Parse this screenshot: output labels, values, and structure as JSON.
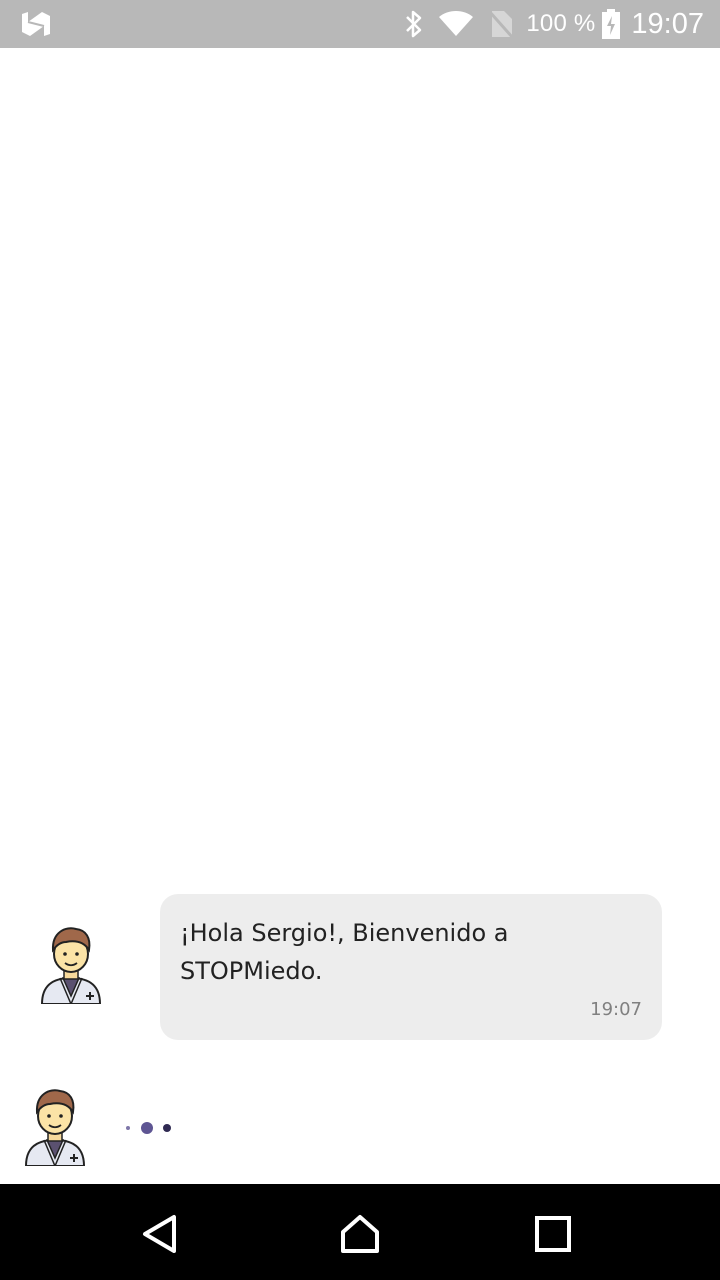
{
  "status_bar": {
    "battery_percent": "100 %",
    "time": "19:07",
    "icons": [
      "n-logo-icon",
      "bluetooth-icon",
      "wifi-icon",
      "no-sim-icon",
      "battery-charging-icon"
    ]
  },
  "chat": {
    "messages": [
      {
        "sender": "bot",
        "avatar": "doctor-avatar-icon",
        "text": "¡Hola Sergio!, Bienvenido a STOPMiedo.",
        "time": "19:07"
      }
    ],
    "typing_indicator": {
      "avatar": "doctor-avatar-icon",
      "dot_color": "#5e5593"
    },
    "bubble_color": "#ededed"
  },
  "nav_bar": {
    "icons": [
      "back-icon",
      "home-icon",
      "recent-apps-icon"
    ]
  }
}
